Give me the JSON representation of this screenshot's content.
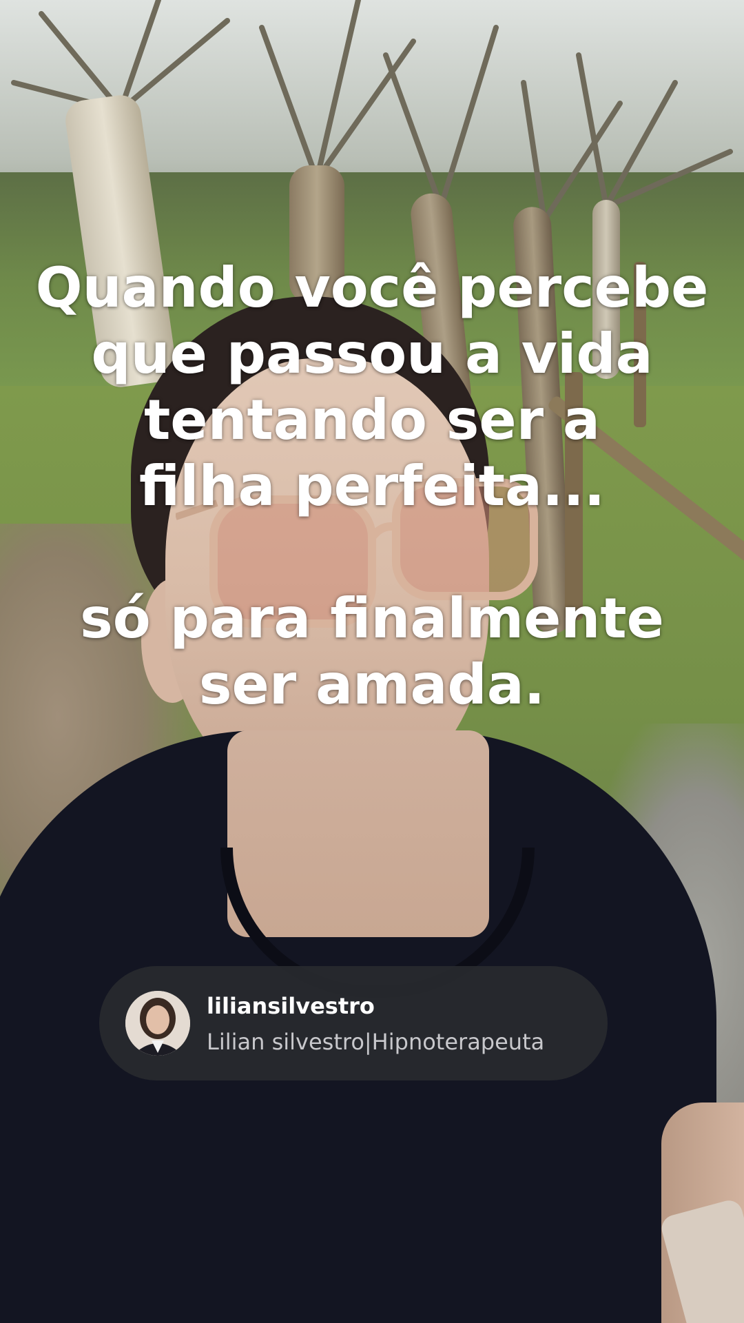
{
  "overlay": {
    "caption_lines": [
      "Quando você percebe",
      "que passou a vida",
      "tentando ser a",
      "filha perfeita...",
      "só para finalmente",
      "ser amada."
    ]
  },
  "profile": {
    "username": "liliansilvestro",
    "display_name": "Lilian silvestro|Hipnoterapeuta"
  },
  "colors": {
    "caption_text": "#ffffff",
    "chip_background": "#2a2c30",
    "username_text": "#ffffff",
    "display_name_text": "#c8c8cc"
  }
}
